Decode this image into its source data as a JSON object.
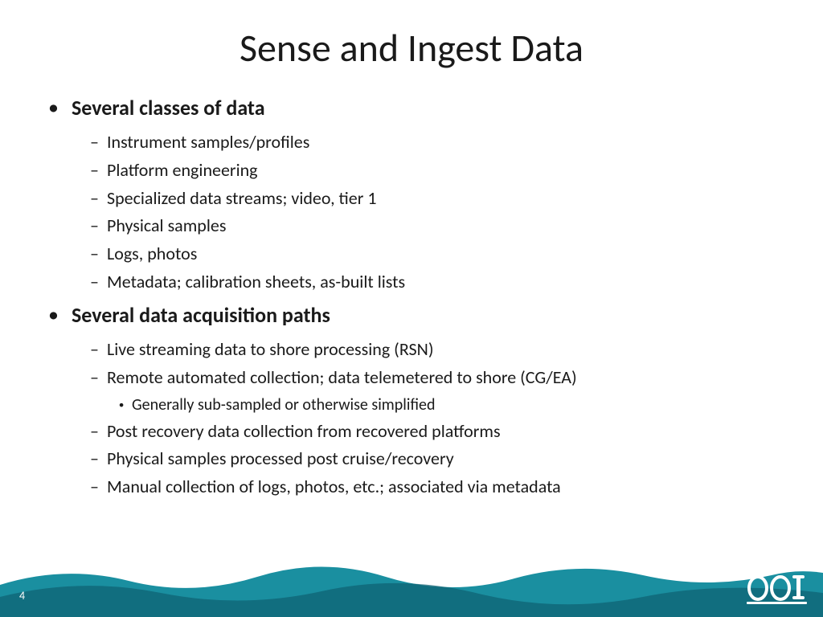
{
  "slide": {
    "title": "Sense and Ingest Data",
    "slide_number": "4",
    "main_bullets": [
      {
        "id": "bullet-1",
        "text": "Several classes of data",
        "sub_items": [
          {
            "id": "sub-1-1",
            "text": "Instrument samples/profiles",
            "sub_sub_items": []
          },
          {
            "id": "sub-1-2",
            "text": "Platform engineering",
            "sub_sub_items": []
          },
          {
            "id": "sub-1-3",
            "text": "Specialized data streams; video, tier 1",
            "sub_sub_items": []
          },
          {
            "id": "sub-1-4",
            "text": "Physical samples",
            "sub_sub_items": []
          },
          {
            "id": "sub-1-5",
            "text": "Logs, photos",
            "sub_sub_items": []
          },
          {
            "id": "sub-1-6",
            "text": "Metadata; calibration sheets, as-built lists",
            "sub_sub_items": []
          }
        ]
      },
      {
        "id": "bullet-2",
        "text": "Several data acquisition paths",
        "sub_items": [
          {
            "id": "sub-2-1",
            "text": "Live streaming data to shore processing (RSN)",
            "sub_sub_items": []
          },
          {
            "id": "sub-2-2",
            "text": "Remote automated collection; data telemetered to shore (CG/EA)",
            "sub_sub_items": [
              {
                "id": "sub-sub-2-2-1",
                "text": "Generally sub-sampled or otherwise simplified"
              }
            ]
          },
          {
            "id": "sub-2-3",
            "text": "Post recovery data collection from recovered platforms",
            "sub_sub_items": []
          },
          {
            "id": "sub-2-4",
            "text": "Physical samples processed post cruise/recovery",
            "sub_sub_items": []
          },
          {
            "id": "sub-2-5",
            "text": "Manual collection of logs, photos, etc.; associated via metadata",
            "sub_sub_items": []
          }
        ]
      }
    ],
    "logo": "OOI",
    "colors": {
      "wave_teal": "#1a8fa0",
      "wave_dark": "#0e6070",
      "background": "#ffffff"
    }
  }
}
